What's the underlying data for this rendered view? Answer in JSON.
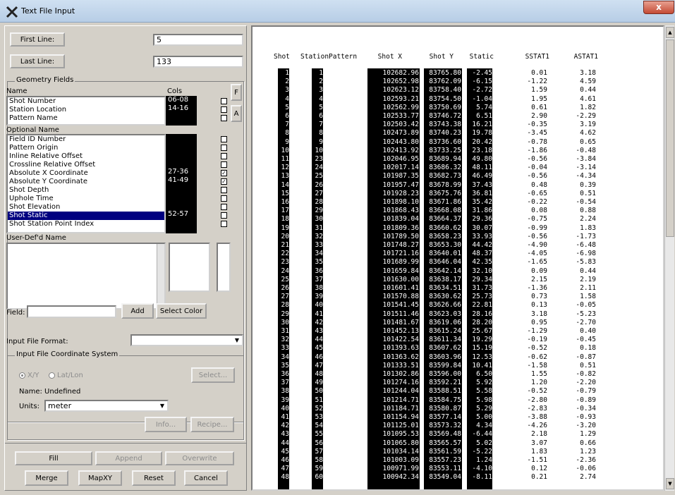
{
  "window": {
    "title": "Text File Input",
    "close_label": "x"
  },
  "lines": {
    "first_label": "First Line:",
    "first_value": "5",
    "last_label": "Last Line:",
    "last_value": "133"
  },
  "geometry": {
    "group_label": "Geometry Fields",
    "name_header": "Name",
    "cols_header": "Cols",
    "f_button": "F",
    "a_button": "A",
    "required": [
      {
        "name": "Shot Number",
        "cols": "06-08"
      },
      {
        "name": "Station Location",
        "cols": "14-16"
      },
      {
        "name": "Pattern Name",
        "cols": ""
      }
    ],
    "optional_header": "Optional Name",
    "optional": [
      {
        "name": "Field ID Number",
        "cols": "",
        "checked": false
      },
      {
        "name": "Pattern Origin",
        "cols": "",
        "checked": false
      },
      {
        "name": "Inline Relative Offset",
        "cols": "",
        "checked": false
      },
      {
        "name": "Crossline Relative Offset",
        "cols": "",
        "checked": false
      },
      {
        "name": "Absolute X Coordinate",
        "cols": "27-36",
        "checked": true
      },
      {
        "name": "Absolute Y Coordinate",
        "cols": "41-49",
        "checked": true
      },
      {
        "name": "Shot Depth",
        "cols": "",
        "checked": false
      },
      {
        "name": "Uphole Time",
        "cols": "",
        "checked": false
      },
      {
        "name": "Shot Elevation",
        "cols": "",
        "checked": false
      },
      {
        "name": "Shot Static",
        "cols": "52-57",
        "checked": false,
        "selected": true
      },
      {
        "name": "Shot Station Point Index",
        "cols": "",
        "checked": false
      }
    ],
    "userdef_header": "User-Def'd Name",
    "field_label": "Field:",
    "field_value": "",
    "add_label": "Add",
    "select_color_label": "Select Color"
  },
  "format": {
    "label": "Input File Format:",
    "value": ""
  },
  "coord": {
    "group_label": "Input File Coordinate System",
    "xy_label": "X/Y",
    "latlon_label": "Lat/Lon",
    "select_label": "Select...",
    "name_text": "Name:  Undefined",
    "units_label": "Units:",
    "units_value": "meter",
    "info_label": "Info...",
    "recipe_label": "Recipe..."
  },
  "actions": {
    "fill": "Fill",
    "append": "Append",
    "overwrite": "Overwrite",
    "merge": "Merge",
    "mapxy": "MapXY",
    "reset": "Reset",
    "cancel": "Cancel"
  },
  "table": {
    "headers": [
      "Shot",
      "StationPattern",
      "Shot X",
      "Shot Y",
      "Static",
      "SSTAT1",
      "ASTAT1"
    ],
    "rows": [
      [
        "1",
        "1",
        "102682.96",
        "83765.80",
        "-2.45",
        "0.01",
        "3.18"
      ],
      [
        "2",
        "2",
        "102652.98",
        "83762.09",
        "-6.15",
        "-1.22",
        "4.59"
      ],
      [
        "3",
        "3",
        "102623.12",
        "83758.40",
        "-2.72",
        "1.59",
        "0.44"
      ],
      [
        "4",
        "4",
        "102593.21",
        "83754.50",
        "-1.04",
        "1.95",
        "4.61"
      ],
      [
        "5",
        "5",
        "102562.99",
        "83750.69",
        "5.74",
        "0.61",
        "1.82"
      ],
      [
        "6",
        "6",
        "102533.77",
        "83746.72",
        "6.51",
        "2.90",
        "-2.29"
      ],
      [
        "7",
        "7",
        "102503.42",
        "83743.38",
        "16.21",
        "-0.35",
        "3.19"
      ],
      [
        "8",
        "8",
        "102473.89",
        "83740.23",
        "19.78",
        "-3.45",
        "4.62"
      ],
      [
        "9",
        "9",
        "102443.80",
        "83736.60",
        "20.42",
        "-0.78",
        "0.65"
      ],
      [
        "10",
        "10",
        "102413.92",
        "83733.25",
        "23.18",
        "-1.86",
        "-0.48"
      ],
      [
        "11",
        "23",
        "102046.95",
        "83689.94",
        "49.80",
        "-0.56",
        "-3.84"
      ],
      [
        "12",
        "24",
        "102017.14",
        "83686.32",
        "48.11",
        "-0.04",
        "-3.14"
      ],
      [
        "13",
        "25",
        "101987.35",
        "83682.73",
        "46.49",
        "-0.56",
        "-4.34"
      ],
      [
        "14",
        "26",
        "101957.47",
        "83678.99",
        "37.43",
        "0.48",
        "0.39"
      ],
      [
        "15",
        "27",
        "101928.23",
        "83675.76",
        "36.81",
        "-0.65",
        "0.51"
      ],
      [
        "16",
        "28",
        "101898.10",
        "83671.86",
        "35.42",
        "-0.22",
        "-0.54"
      ],
      [
        "17",
        "29",
        "101868.43",
        "83668.08",
        "31.86",
        "0.08",
        "0.88"
      ],
      [
        "18",
        "30",
        "101839.04",
        "83664.37",
        "29.36",
        "-0.75",
        "2.24"
      ],
      [
        "19",
        "31",
        "101809.36",
        "83660.62",
        "30.07",
        "-0.99",
        "1.83"
      ],
      [
        "20",
        "32",
        "101789.50",
        "83658.23",
        "33.93",
        "-0.56",
        "-1.73"
      ],
      [
        "21",
        "33",
        "101748.27",
        "83653.30",
        "44.42",
        "-4.90",
        "-6.48"
      ],
      [
        "22",
        "34",
        "101721.16",
        "83640.01",
        "48.37",
        "-4.05",
        "-6.98"
      ],
      [
        "23",
        "35",
        "101689.99",
        "83646.04",
        "42.35",
        "-1.65",
        "-5.83"
      ],
      [
        "24",
        "36",
        "101659.84",
        "83642.14",
        "32.10",
        "0.09",
        "0.44"
      ],
      [
        "25",
        "37",
        "101630.00",
        "83638.17",
        "29.34",
        "2.15",
        "2.19"
      ],
      [
        "26",
        "38",
        "101601.41",
        "83634.51",
        "31.73",
        "-1.36",
        "2.11"
      ],
      [
        "27",
        "39",
        "101570.88",
        "83630.62",
        "25.73",
        "0.73",
        "1.58"
      ],
      [
        "28",
        "40",
        "101541.45",
        "83626.66",
        "22.81",
        "0.13",
        "-0.05"
      ],
      [
        "29",
        "41",
        "101511.46",
        "83623.03",
        "28.16",
        "3.18",
        "-5.23"
      ],
      [
        "30",
        "42",
        "101481.67",
        "83619.06",
        "28.20",
        "0.95",
        "-2.70"
      ],
      [
        "31",
        "43",
        "101452.13",
        "83615.24",
        "25.67",
        "-1.29",
        "0.40"
      ],
      [
        "32",
        "44",
        "101422.54",
        "83611.34",
        "19.29",
        "-0.19",
        "-0.45"
      ],
      [
        "33",
        "45",
        "101393.63",
        "83607.62",
        "15.19",
        "-0.52",
        "0.18"
      ],
      [
        "34",
        "46",
        "101363.62",
        "83603.96",
        "12.53",
        "-0.62",
        "-0.87"
      ],
      [
        "35",
        "47",
        "101333.51",
        "83599.84",
        "10.41",
        "-1.58",
        "0.51"
      ],
      [
        "36",
        "48",
        "101302.86",
        "83596.00",
        "6.50",
        "1.55",
        "-0.82"
      ],
      [
        "37",
        "49",
        "101274.16",
        "83592.21",
        "5.92",
        "1.20",
        "-2.20"
      ],
      [
        "38",
        "50",
        "101244.04",
        "83588.51",
        "5.58",
        "-0.52",
        "-0.79"
      ],
      [
        "39",
        "51",
        "101214.71",
        "83584.75",
        "5.98",
        "-2.80",
        "-0.89"
      ],
      [
        "40",
        "52",
        "101184.71",
        "83580.87",
        "5.29",
        "-2.83",
        "-0.34"
      ],
      [
        "41",
        "53",
        "101154.94",
        "83577.14",
        "5.00",
        "-3.88",
        "-0.93"
      ],
      [
        "42",
        "54",
        "101125.01",
        "83573.32",
        "4.34",
        "-4.26",
        "-3.20"
      ],
      [
        "43",
        "55",
        "101095.53",
        "83569.48",
        "-6.44",
        "2.18",
        "1.29"
      ],
      [
        "44",
        "56",
        "101065.80",
        "83565.57",
        "5.02",
        "3.07",
        "0.66"
      ],
      [
        "45",
        "57",
        "101034.14",
        "83561.59",
        "-5.22",
        "1.83",
        "1.23"
      ],
      [
        "46",
        "58",
        "101003.09",
        "83557.23",
        "1.24",
        "-1.51",
        "-2.36"
      ],
      [
        "47",
        "59",
        "100971.99",
        "83553.11",
        "-4.10",
        "0.12",
        "-0.06"
      ],
      [
        "48",
        "60",
        "100942.34",
        "83549.04",
        "-8.11",
        "0.21",
        "2.74"
      ]
    ]
  }
}
